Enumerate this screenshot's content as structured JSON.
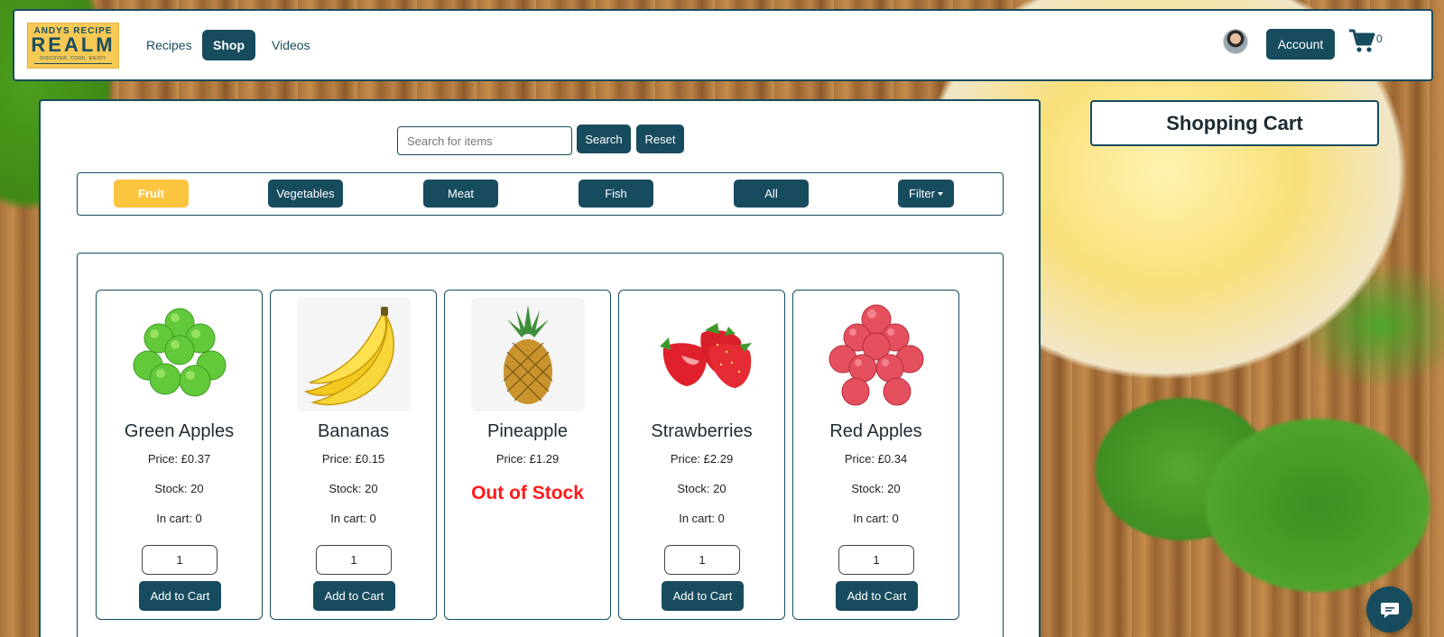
{
  "logo": {
    "line1": "ANDYS RECIPE",
    "line2": "REALM",
    "tagline": "DISCOVER, COOK, ENJOY"
  },
  "nav": {
    "links": [
      {
        "label": "Recipes",
        "active": false
      },
      {
        "label": "Shop",
        "active": true
      },
      {
        "label": "Videos",
        "active": false
      }
    ],
    "account_label": "Account",
    "cart_count": "0"
  },
  "search": {
    "placeholder": "Search for items",
    "value": "",
    "search_label": "Search",
    "reset_label": "Reset"
  },
  "categories": [
    {
      "label": "Fruit",
      "active": true
    },
    {
      "label": "Vegetables",
      "active": false
    },
    {
      "label": "Meat",
      "active": false
    },
    {
      "label": "Fish",
      "active": false
    },
    {
      "label": "All",
      "active": false
    }
  ],
  "filter_label": "Filter",
  "products": [
    {
      "name": "Green Apples",
      "price": "Price: £0.37",
      "stock": "Stock: 20",
      "in_cart": "In cart: 0",
      "quantity": "1",
      "add_label": "Add to Cart",
      "image": "green-apples-image"
    },
    {
      "name": "Bananas",
      "price": "Price: £0.15",
      "stock": "Stock: 20",
      "in_cart": "In cart: 0",
      "quantity": "1",
      "add_label": "Add to Cart",
      "image": "bananas-image"
    },
    {
      "name": "Pineapple",
      "price": "Price: £1.29",
      "out_of_stock": "Out of Stock",
      "image": "pineapple-image"
    },
    {
      "name": "Strawberries",
      "price": "Price: £2.29",
      "stock": "Stock: 20",
      "in_cart": "In cart: 0",
      "quantity": "1",
      "add_label": "Add to Cart",
      "image": "strawberries-image"
    },
    {
      "name": "Red Apples",
      "price": "Price: £0.34",
      "stock": "Stock: 20",
      "in_cart": "In cart: 0",
      "quantity": "1",
      "add_label": "Add to Cart",
      "image": "red-apples-image"
    }
  ],
  "cart_panel": {
    "title": "Shopping Cart"
  },
  "colors": {
    "primary": "#174c5f",
    "accent": "#fcc540",
    "danger": "#ff1a1a"
  },
  "icons": {
    "cart": "shopping-cart-icon",
    "chat": "chat-bubble-icon"
  }
}
